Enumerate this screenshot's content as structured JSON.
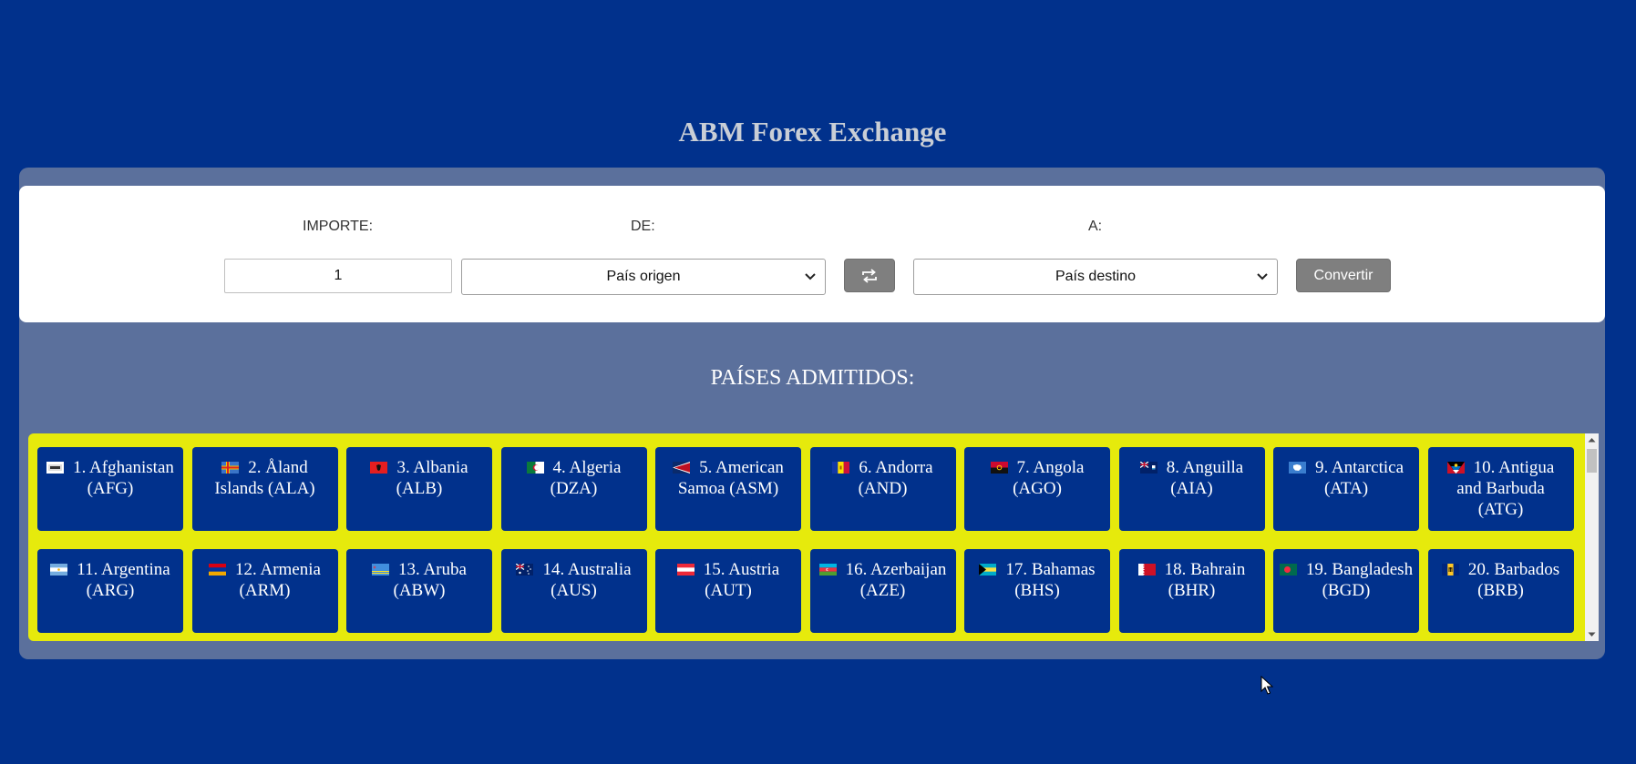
{
  "app_title": "ABM Forex Exchange",
  "converter": {
    "amount_label": "IMPORTE:",
    "from_label": "DE:",
    "to_label": "A:",
    "amount_value": "1",
    "from_select": "País origen",
    "to_select": "País destino",
    "swap_icon": "swap-arrows-icon",
    "convert_label": "Convertir"
  },
  "section_title": "PAÍSES ADMITIDOS:",
  "countries": [
    {
      "label": "1. Afghanistan (AFG)",
      "flag": "flag-afghanistan"
    },
    {
      "label": "2. Åland Islands (ALA)",
      "flag": "flag-aland"
    },
    {
      "label": "3. Albania (ALB)",
      "flag": "flag-albania"
    },
    {
      "label": "4. Algeria (DZA)",
      "flag": "flag-algeria"
    },
    {
      "label": "5. American Samoa (ASM)",
      "flag": "flag-american-samoa"
    },
    {
      "label": "6. Andorra (AND)",
      "flag": "flag-andorra"
    },
    {
      "label": "7. Angola (AGO)",
      "flag": "flag-angola"
    },
    {
      "label": "8. Anguilla (AIA)",
      "flag": "flag-anguilla"
    },
    {
      "label": "9. Antarctica (ATA)",
      "flag": "flag-antarctica"
    },
    {
      "label": "10. Antigua and Barbuda (ATG)",
      "flag": "flag-antigua"
    },
    {
      "label": "11. Argentina (ARG)",
      "flag": "flag-argentina"
    },
    {
      "label": "12. Armenia (ARM)",
      "flag": "flag-armenia"
    },
    {
      "label": "13. Aruba (ABW)",
      "flag": "flag-aruba"
    },
    {
      "label": "14. Australia (AUS)",
      "flag": "flag-australia"
    },
    {
      "label": "15. Austria (AUT)",
      "flag": "flag-austria"
    },
    {
      "label": "16. Azerbaijan (AZE)",
      "flag": "flag-azerbaijan"
    },
    {
      "label": "17. Bahamas (BHS)",
      "flag": "flag-bahamas"
    },
    {
      "label": "18. Bahrain (BHR)",
      "flag": "flag-bahrain"
    },
    {
      "label": "19. Bangladesh (BGD)",
      "flag": "flag-bangladesh"
    },
    {
      "label": "20. Barbados (BRB)",
      "flag": "flag-barbados"
    }
  ],
  "colors": {
    "page_bg": "#01318c",
    "panel_bg": "#5b709c",
    "countries_bg": "#e6ea0c",
    "card_bg": "#01318c",
    "button_bg": "#7f7f7f"
  }
}
